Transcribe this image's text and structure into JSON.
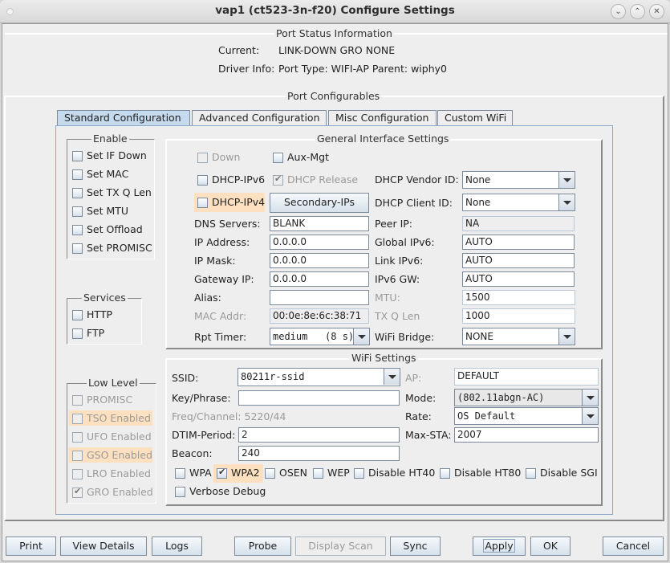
{
  "window": {
    "title": "vap1  (ct523-3n-f20) Configure Settings",
    "controls": {
      "minimize": "⌄",
      "maximize": "⌃",
      "close": "✕"
    }
  },
  "port_status": {
    "legend": "Port Status Information",
    "current_label": "Current:",
    "current_value": "LINK-DOWN GRO  NONE",
    "driver_label": "Driver Info:",
    "driver_value": "Port Type: WIFI-AP   Parent: wiphy0"
  },
  "port_config": {
    "legend": "Port Configurables",
    "tabs": [
      {
        "label": "Standard Configuration",
        "active": true
      },
      {
        "label": "Advanced Configuration",
        "active": false
      },
      {
        "label": "Misc Configuration",
        "active": false
      },
      {
        "label": "Custom WiFi",
        "active": false
      }
    ]
  },
  "enable": {
    "legend": "Enable",
    "items": [
      {
        "label": "Set IF Down",
        "checked": false
      },
      {
        "label": "Set MAC",
        "checked": false
      },
      {
        "label": "Set TX Q Len",
        "checked": false
      },
      {
        "label": "Set MTU",
        "checked": false
      },
      {
        "label": "Set Offload",
        "checked": false
      },
      {
        "label": "Set PROMISC",
        "checked": false
      }
    ]
  },
  "services": {
    "legend": "Services",
    "items": [
      {
        "label": "HTTP",
        "checked": false
      },
      {
        "label": "FTP",
        "checked": false
      }
    ]
  },
  "low_level": {
    "legend": "Low Level",
    "items": [
      {
        "label": "PROMISC",
        "checked": false,
        "highlight": false
      },
      {
        "label": "TSO Enabled",
        "checked": false,
        "highlight": true
      },
      {
        "label": "UFO Enabled",
        "checked": false,
        "highlight": false
      },
      {
        "label": "GSO Enabled",
        "checked": false,
        "highlight": true
      },
      {
        "label": "LRO Enabled",
        "checked": false,
        "highlight": false
      },
      {
        "label": "GRO Enabled",
        "checked": true,
        "highlight": false
      }
    ]
  },
  "general": {
    "legend": "General Interface Settings",
    "down": {
      "label": "Down",
      "checked": false
    },
    "aux_mgt": {
      "label": "Aux-Mgt",
      "checked": false
    },
    "dhcp_ipv6": {
      "label": "DHCP-IPv6",
      "checked": false
    },
    "dhcp_release": {
      "label": "DHCP Release",
      "checked": true
    },
    "dhcp_ipv4": {
      "label": "DHCP-IPv4",
      "checked": false
    },
    "secondary_ips_button": "Secondary-IPs",
    "dhcp_vendor_id": {
      "label": "DHCP Vendor ID:",
      "value": "None"
    },
    "dhcp_client_id": {
      "label": "DHCP Client ID:",
      "value": "None"
    },
    "dns_servers": {
      "label": "DNS Servers:",
      "value": "BLANK"
    },
    "peer_ip": {
      "label": "Peer IP:",
      "value": "NA"
    },
    "ip_address": {
      "label": "IP Address:",
      "value": "0.0.0.0"
    },
    "global_ipv6": {
      "label": "Global IPv6:",
      "value": "AUTO"
    },
    "ip_mask": {
      "label": "IP Mask:",
      "value": "0.0.0.0"
    },
    "link_ipv6": {
      "label": "Link IPv6:",
      "value": "AUTO"
    },
    "gateway_ip": {
      "label": "Gateway IP:",
      "value": "0.0.0.0"
    },
    "ipv6_gw": {
      "label": "IPv6 GW:",
      "value": "AUTO"
    },
    "alias": {
      "label": "Alias:",
      "value": ""
    },
    "mtu": {
      "label": "MTU:",
      "value": "1500"
    },
    "mac_addr": {
      "label": "MAC Addr:",
      "value": "00:0e:8e:6c:38:71"
    },
    "tx_q_len": {
      "label": "TX Q Len",
      "value": "1000"
    },
    "rpt_timer": {
      "label": "Rpt Timer:",
      "value": "medium   (8 s)"
    },
    "wifi_bridge": {
      "label": "WiFi Bridge:",
      "value": "NONE"
    }
  },
  "wifi": {
    "legend": "WiFi Settings",
    "ssid": {
      "label": "SSID:",
      "value": "80211r-ssid"
    },
    "ap": {
      "label": "AP:",
      "value": "DEFAULT"
    },
    "key_phrase": {
      "label": "Key/Phrase:",
      "value": ""
    },
    "mode": {
      "label": "Mode:",
      "value": "(802.11abgn-AC)"
    },
    "freq_channel": "Freq/Channel: 5220/44",
    "rate": {
      "label": "Rate:",
      "value": "OS Default"
    },
    "dtim_period": {
      "label": "DTIM-Period:",
      "value": "2"
    },
    "max_sta": {
      "label": "Max-STA:",
      "value": "2007"
    },
    "beacon": {
      "label": "Beacon:",
      "value": "240"
    },
    "flags": [
      {
        "label": "WPA",
        "checked": false,
        "highlight": false
      },
      {
        "label": "WPA2",
        "checked": true,
        "highlight": true
      },
      {
        "label": "OSEN",
        "checked": false,
        "highlight": false
      },
      {
        "label": "WEP",
        "checked": false,
        "highlight": false
      },
      {
        "label": "Disable HT40",
        "checked": false,
        "highlight": false
      },
      {
        "label": "Disable HT80",
        "checked": false,
        "highlight": false
      },
      {
        "label": "Disable SGI",
        "checked": false,
        "highlight": false
      }
    ],
    "verbose_debug": {
      "label": "Verbose Debug",
      "checked": false
    }
  },
  "buttons": {
    "print": "Print",
    "view_details": "View Details",
    "logs": "Logs",
    "probe": "Probe",
    "display_scan": "Display Scan",
    "sync": "Sync",
    "apply": "Apply",
    "ok": "OK",
    "cancel": "Cancel"
  },
  "colors": {
    "highlight": "#fde0c0",
    "active_tab": "#c6daee",
    "tab_border": "#8aa8c8"
  }
}
